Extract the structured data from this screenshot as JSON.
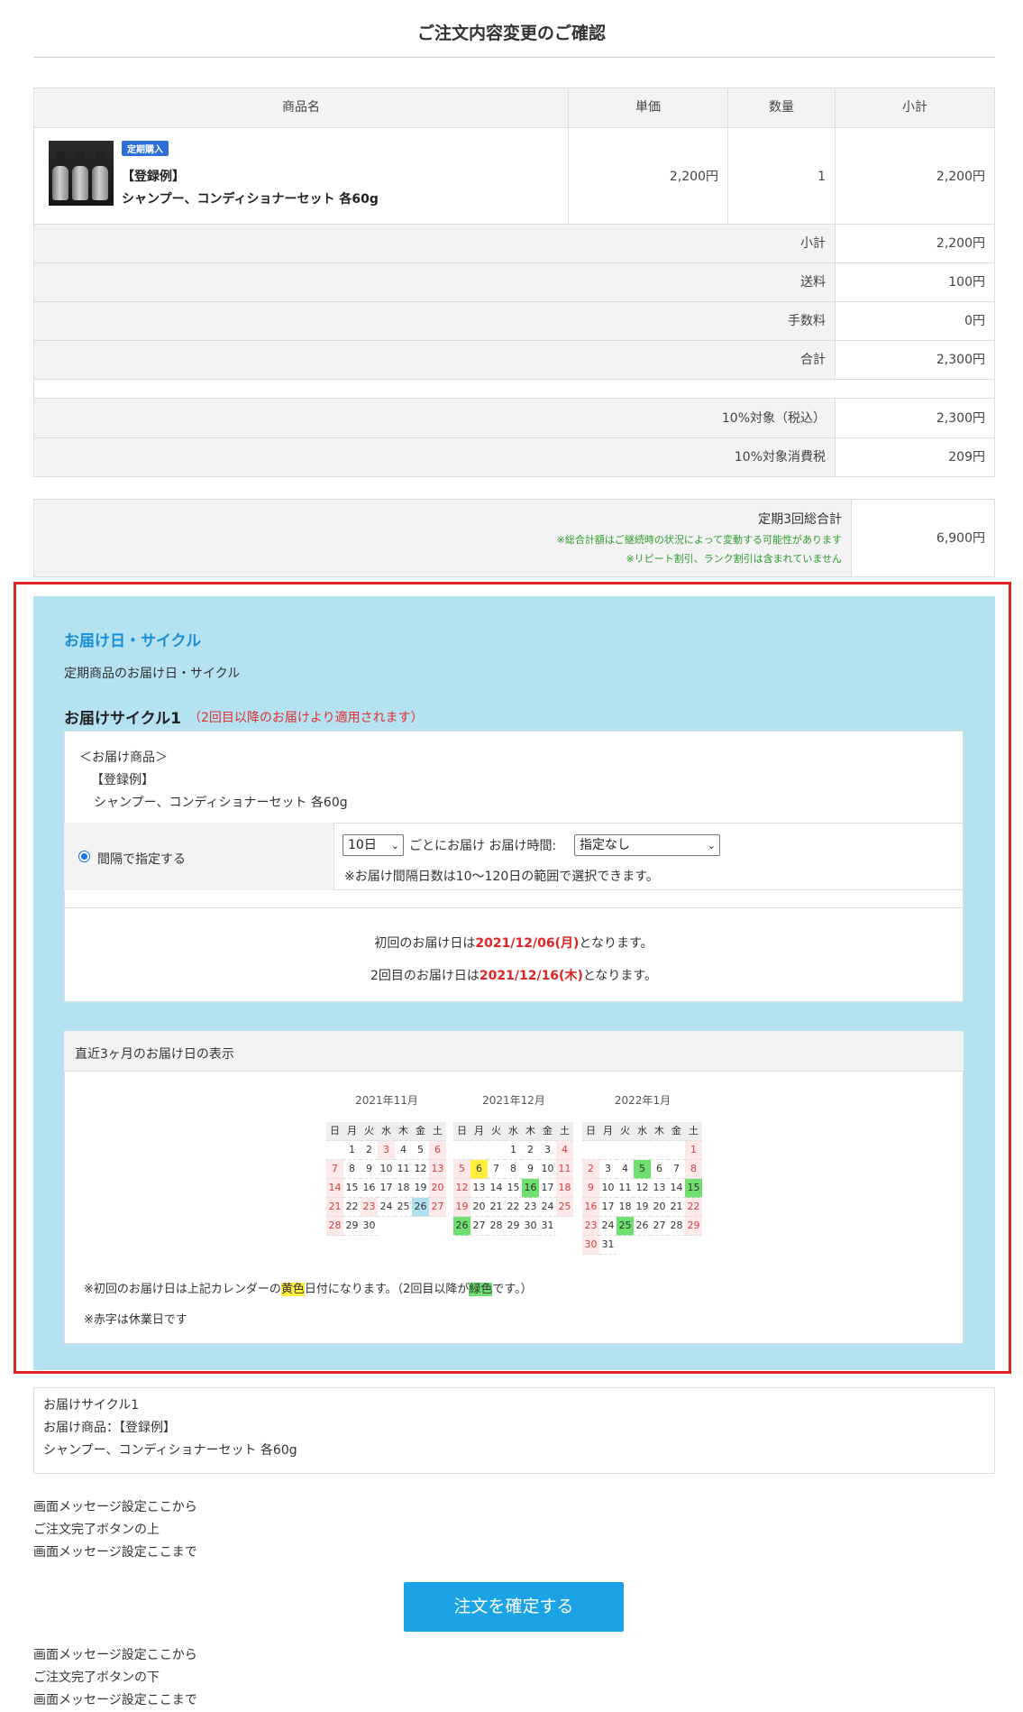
{
  "page": {
    "title": "ご注文内容変更のご確認"
  },
  "order_table": {
    "headers": {
      "name": "商品名",
      "price": "単価",
      "qty": "数量",
      "subtotal": "小計"
    },
    "item": {
      "badge": "定期購入",
      "name_line1": "【登録例】",
      "name_line2": "シャンプー、コンディショナーセット 各60g",
      "price": "2,200円",
      "qty": "1",
      "subtotal": "2,200円"
    },
    "rows": [
      {
        "label": "小計",
        "value": "2,200円"
      },
      {
        "label": "送料",
        "value": "100円"
      },
      {
        "label": "手数料",
        "value": "0円"
      },
      {
        "label": "合計",
        "value": "2,300円"
      }
    ],
    "tax_rows": [
      {
        "label": "10%対象（税込）",
        "value": "2,300円"
      },
      {
        "label": "10%対象消費税",
        "value": "209円"
      }
    ]
  },
  "total3": {
    "label": "定期3回総合計",
    "note1": "※総合計額はご継続時の状況によって変動する可能性があります",
    "note2": "※リピート割引、ランク割引は含まれていません",
    "value": "6,900円"
  },
  "delivery": {
    "title": "お届け日・サイクル",
    "subtitle": "定期商品のお届け日・サイクル",
    "cycle_title": "お届けサイクル1",
    "cycle_note": "（2回目以降のお届けより適用されます）",
    "items_label": "＜お届け商品＞",
    "item_line1": "【登録例】",
    "item_line2": "シャンプー、コンディショナーセット 各60g",
    "interval_label": "間隔で指定する",
    "interval_value": "10日",
    "interval_text": "ごとにお届け お届け時間:",
    "time_value": "指定なし",
    "interval_note": "※お届け間隔日数は10〜120日の範囲で選択できます。",
    "first_prefix": "初回のお届け日は",
    "first_date": "2021/12/06(月)",
    "first_suffix": "となります。",
    "second_prefix": "2回目のお届け日は",
    "second_date": "2021/12/16(木)",
    "second_suffix": "となります。",
    "calendar_head": "直近3ヶ月のお届け日の表示",
    "calendar_note_a": "※初回のお届け日は上記カレンダーの",
    "calendar_note_yellow": "黄色",
    "calendar_note_b": "日付になります。（2回目以降が",
    "calendar_note_green": "緑色",
    "calendar_note_c": "です。）",
    "calendar_note2": "※赤字は休業日です",
    "weekdays": [
      "日",
      "月",
      "火",
      "水",
      "木",
      "金",
      "土"
    ],
    "months": [
      {
        "title": "2021年11月",
        "start": 1,
        "days": 30,
        "red": [
          3,
          6,
          7,
          13,
          14,
          20,
          21,
          23,
          27,
          28
        ],
        "yellow": [],
        "green": [],
        "blue": [
          26
        ]
      },
      {
        "title": "2021年12月",
        "start": 3,
        "days": 31,
        "red": [
          4,
          5,
          11,
          12,
          18,
          19,
          25,
          26
        ],
        "yellow": [
          6
        ],
        "green": [
          16,
          26
        ],
        "blue": []
      },
      {
        "title": "2022年1月",
        "start": 6,
        "days": 31,
        "red": [
          1,
          2,
          8,
          9,
          15,
          16,
          22,
          23,
          29,
          30
        ],
        "yellow": [],
        "green": [
          5,
          15,
          25
        ],
        "blue": []
      }
    ]
  },
  "summary": {
    "line1": "お届けサイクル1",
    "line2": "お届け商品：【登録例】",
    "line3": "シャンプー、コンディショナーセット 各60g"
  },
  "messages_top": [
    "画面メッセージ設定ここから",
    "ご注文完了ボタンの上",
    "画面メッセージ設定ここまで"
  ],
  "confirm_button": "注文を確定する",
  "messages_bottom": [
    "画面メッセージ設定ここから",
    "ご注文完了ボタンの下",
    "画面メッセージ設定ここまで"
  ]
}
